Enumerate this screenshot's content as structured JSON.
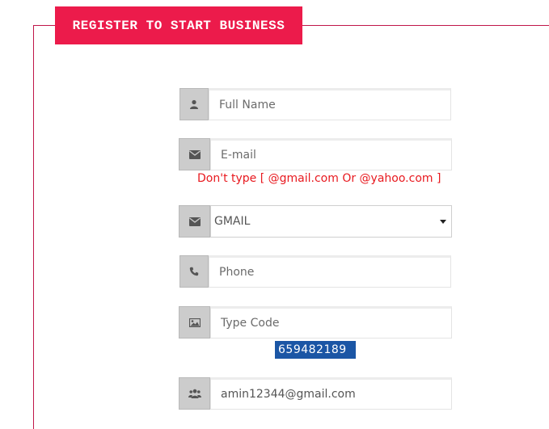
{
  "section": {
    "legend": "REGISTER TO START BUSINESS"
  },
  "form": {
    "full_name": {
      "placeholder": "Full Name",
      "icon": "user-icon"
    },
    "email": {
      "placeholder": "E-mail",
      "icon": "envelope-icon"
    },
    "email_hint": "Don't type [ @gmail.com Or @yahoo.com ]",
    "email_domain": {
      "selected": "GMAIL",
      "icon": "envelope-icon"
    },
    "phone": {
      "placeholder": "Phone",
      "icon": "phone-icon"
    },
    "captcha_input": {
      "placeholder": "Type Code",
      "icon": "image-icon"
    },
    "captcha_code": "659482189",
    "referrer": {
      "value": "amin12344@gmail.com",
      "icon": "users-icon"
    }
  },
  "colors": {
    "accent": "#ec1b4b",
    "hint": "#e8191f",
    "captcha_bg": "#1b56a5",
    "addon_bg": "#cccccc"
  }
}
